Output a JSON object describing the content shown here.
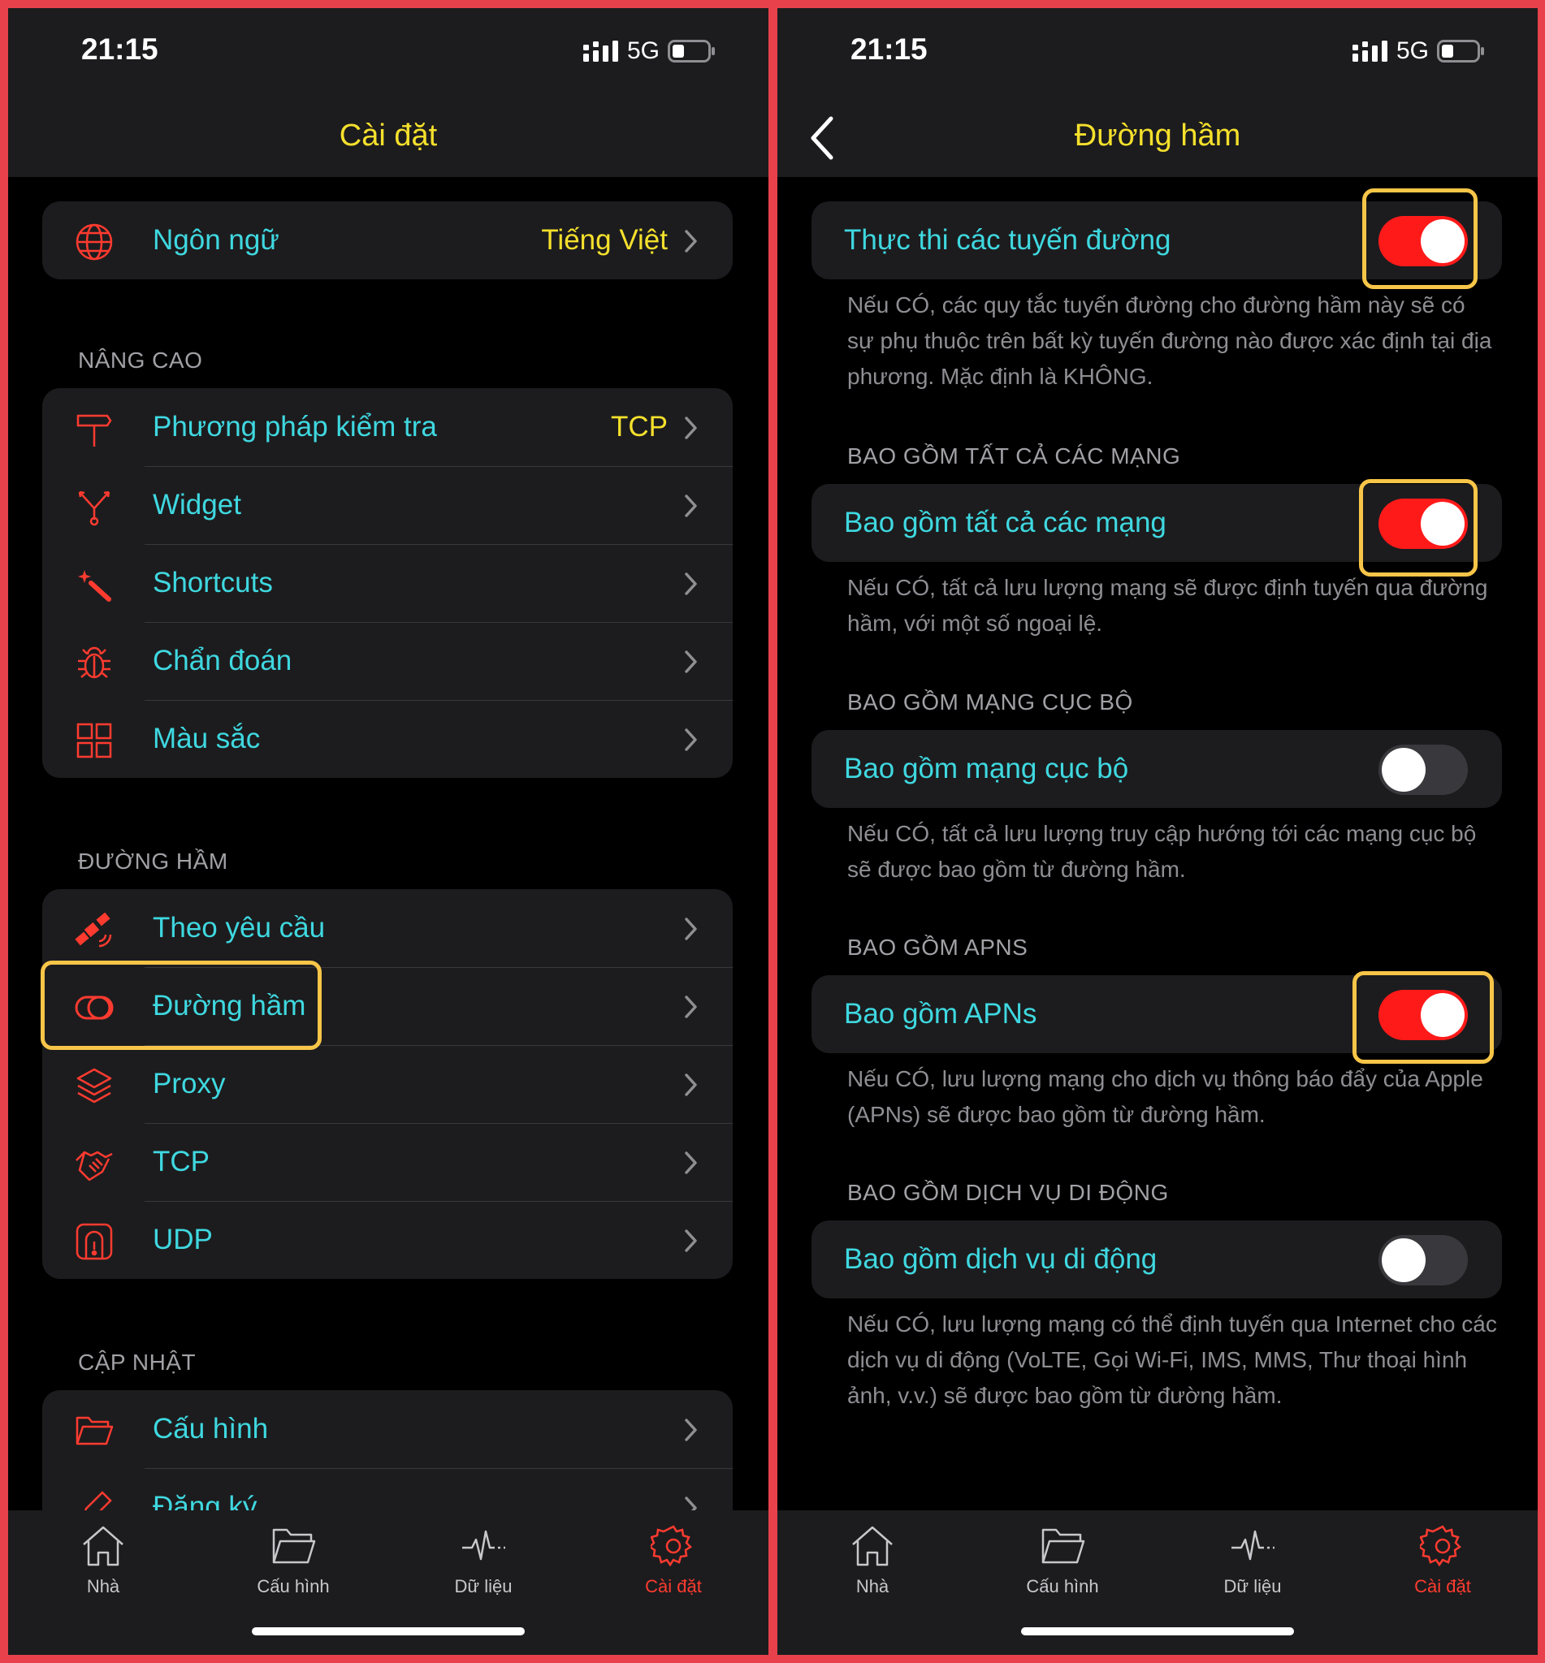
{
  "status": {
    "time": "21:15",
    "network": "5G"
  },
  "left": {
    "title": "Cài đặt",
    "top_row": {
      "label": "Ngôn ngữ",
      "value": "Tiếng Việt",
      "icon": "globe-icon"
    },
    "sections": [
      {
        "header": "NÂNG CAO",
        "items": [
          {
            "label": "Phương pháp kiểm tra",
            "value": "TCP",
            "icon": "signpost-icon"
          },
          {
            "label": "Widget",
            "value": "",
            "icon": "widget-icon"
          },
          {
            "label": "Shortcuts",
            "value": "",
            "icon": "magic-wand-icon"
          },
          {
            "label": "Chẩn đoán",
            "value": "",
            "icon": "bug-icon"
          },
          {
            "label": "Màu sắc",
            "value": "",
            "icon": "grid-icon"
          }
        ]
      },
      {
        "header": "ĐƯỜNG HẦM",
        "items": [
          {
            "label": "Theo yêu cầu",
            "value": "",
            "icon": "satellite-icon"
          },
          {
            "label": "Đường hầm",
            "value": "",
            "icon": "tunnel-icon"
          },
          {
            "label": "Proxy",
            "value": "",
            "icon": "layers-icon"
          },
          {
            "label": "TCP",
            "value": "",
            "icon": "handshake-icon"
          },
          {
            "label": "UDP",
            "value": "",
            "icon": "udp-icon"
          }
        ]
      },
      {
        "header": "CẬP NHẬT",
        "items": [
          {
            "label": "Cấu hình",
            "value": "",
            "icon": "folder-icon"
          },
          {
            "label": "Đăng ký",
            "value": "",
            "icon": "pen-icon"
          }
        ]
      }
    ]
  },
  "right": {
    "title": "Đường hầm",
    "settings": [
      {
        "header": "",
        "label": "Thực thi các tuyến đường",
        "on": true,
        "desc": "Nếu CÓ, các quy tắc tuyến đường cho đường hầm này sẽ có sự phụ thuộc trên bất kỳ tuyến đường nào được xác định tại địa phương. Mặc định là KHÔNG."
      },
      {
        "header": "BAO GỒM TẤT CẢ CÁC MẠNG",
        "label": "Bao gồm tất cả các mạng",
        "on": true,
        "desc": "Nếu CÓ, tất cả lưu lượng mạng sẽ được định tuyến qua đường hầm, với một số ngoại lệ."
      },
      {
        "header": "BAO GỒM MẠNG CỤC BỘ",
        "label": "Bao gồm mạng cục bộ",
        "on": false,
        "desc": "Nếu CÓ, tất cả lưu lượng truy cập hướng tới các mạng cục bộ sẽ được bao gồm từ đường hầm."
      },
      {
        "header": "BAO GỒM APNS",
        "label": "Bao gồm APNs",
        "on": true,
        "desc": "Nếu CÓ, lưu lượng mạng cho dịch vụ thông báo đẩy của Apple (APNs) sẽ được bao gồm từ đường hầm."
      },
      {
        "header": "BAO GỒM DỊCH VỤ DI ĐỘNG",
        "label": "Bao gồm dịch vụ di động",
        "on": false,
        "desc": "Nếu CÓ, lưu lượng mạng có thể định tuyến qua Internet cho các dịch vụ di động (VoLTE, Gọi Wi-Fi, IMS, MMS, Thư thoại hình ảnh, v.v.) sẽ được bao gồm từ đường hầm."
      }
    ]
  },
  "tabs": [
    {
      "label": "Nhà",
      "icon": "home-icon",
      "active": false
    },
    {
      "label": "Cấu hình",
      "icon": "folder-icon",
      "active": false
    },
    {
      "label": "Dữ liệu",
      "icon": "pulse-icon",
      "active": false
    },
    {
      "label": "Cài đặt",
      "icon": "gear-icon",
      "active": true
    }
  ],
  "colors": {
    "accent_yellow": "#f5e02c",
    "label_cyan": "#3fd8e0",
    "icon_red": "#ff3b30",
    "highlight": "#f7c548",
    "toggle_on": "#ff1a1a"
  }
}
